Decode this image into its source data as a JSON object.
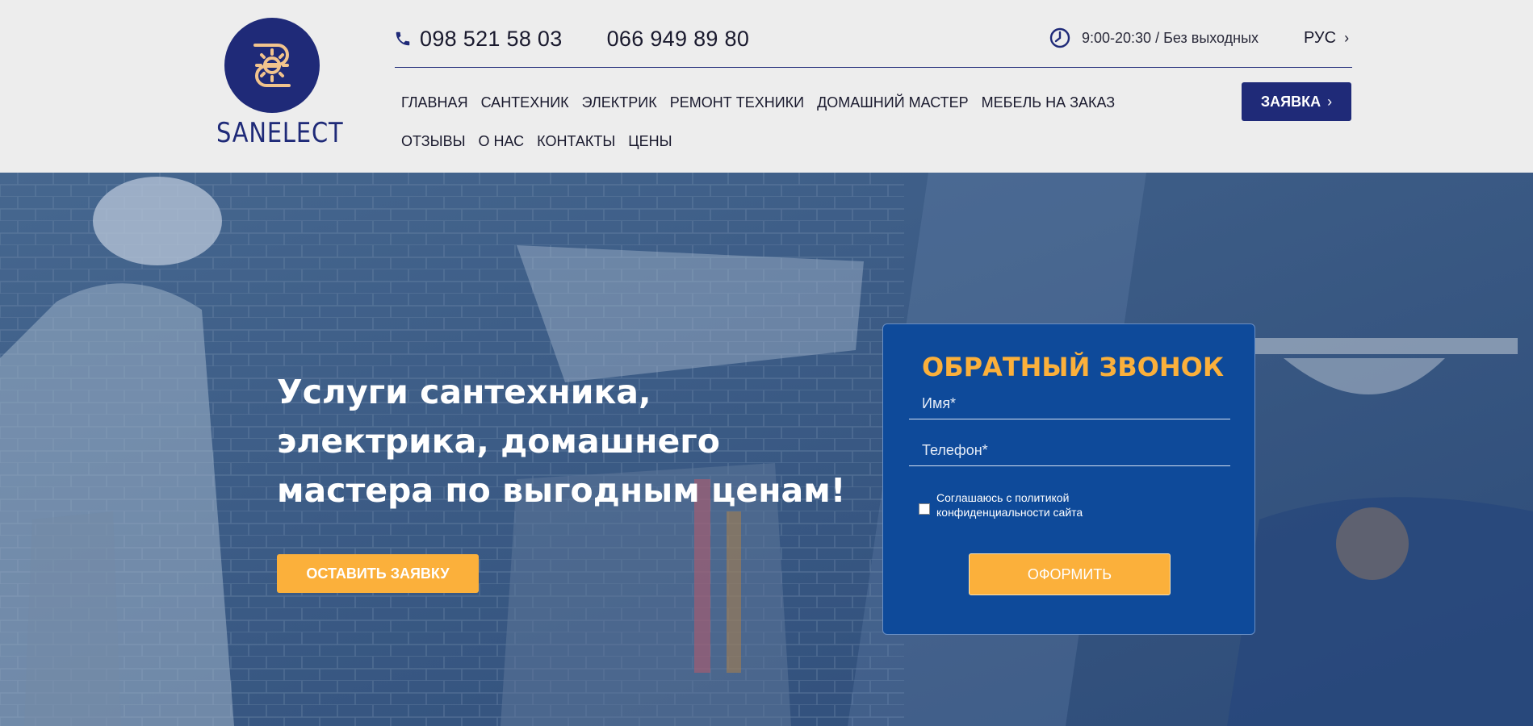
{
  "brand": {
    "logo_text": "SANELECT",
    "primary_color": "#1f2a78",
    "accent_color": "#fbb03b",
    "logo_icon": "sun-pipe-logo-icon"
  },
  "header": {
    "phones": [
      "098 521 58 03",
      "066 949 89 80"
    ],
    "phone_icon": "phone-icon",
    "hours": "9:00-20:30 / Без выходных",
    "hours_icon": "clock-icon",
    "language": "РУС",
    "order_button": "ЗАЯВКА"
  },
  "nav": {
    "row1": [
      "ГЛАВНАЯ",
      "САНТЕХНИК",
      "ЭЛЕКТРИК",
      "РЕМОНТ ТЕХНИКИ",
      "ДОМАШНИЙ МАСТЕР",
      "МЕБЕЛЬ НА ЗАКАЗ"
    ],
    "row2": [
      "ОТЗЫВЫ",
      "О НАС",
      "КОНТАКТЫ",
      "ЦЕНЫ"
    ]
  },
  "hero": {
    "title": "Услуги сантехника, электрика, домашнего мастера по выгодным ценам!",
    "button": "ОСТАВИТЬ ЗАЯВКУ"
  },
  "callback_form": {
    "title": "ОБРАТНЫЙ ЗВОНОК",
    "name_placeholder": "Имя*",
    "phone_placeholder": "Телефон*",
    "agree_text": "Соглашаюсь с политикой конфиденциальности сайта",
    "submit": "ОФОРМИТЬ"
  }
}
